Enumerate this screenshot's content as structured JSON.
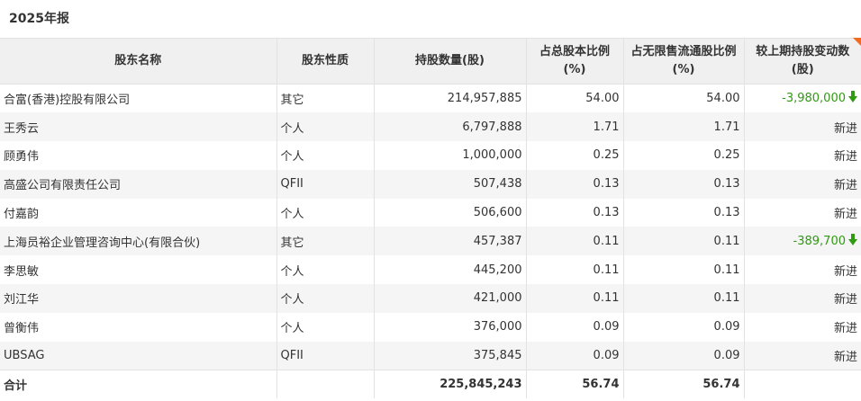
{
  "report_title": "2025年报",
  "columns": {
    "name": "股东名称",
    "type": "股东性质",
    "shares": "持股数量(股)",
    "total_pct": "占总股本比例(%)",
    "float_pct": "占无限售流通股比例(%)",
    "change": "较上期持股变动数(股)"
  },
  "rows": [
    {
      "name": "合富(香港)控股有限公司",
      "type": "其它",
      "shares": "214,957,885",
      "total_pct": "54.00",
      "float_pct": "54.00",
      "change": "-3,980,000",
      "change_dir": "down"
    },
    {
      "name": "王秀云",
      "type": "个人",
      "shares": "6,797,888",
      "total_pct": "1.71",
      "float_pct": "1.71",
      "change": "新进",
      "change_dir": ""
    },
    {
      "name": "顾勇伟",
      "type": "个人",
      "shares": "1,000,000",
      "total_pct": "0.25",
      "float_pct": "0.25",
      "change": "新进",
      "change_dir": ""
    },
    {
      "name": "高盛公司有限责任公司",
      "type": "QFII",
      "shares": "507,438",
      "total_pct": "0.13",
      "float_pct": "0.13",
      "change": "新进",
      "change_dir": ""
    },
    {
      "name": "付嘉韵",
      "type": "个人",
      "shares": "506,600",
      "total_pct": "0.13",
      "float_pct": "0.13",
      "change": "新进",
      "change_dir": ""
    },
    {
      "name": "上海员裕企业管理咨询中心(有限合伙)",
      "type": "其它",
      "shares": "457,387",
      "total_pct": "0.11",
      "float_pct": "0.11",
      "change": "-389,700",
      "change_dir": "down"
    },
    {
      "name": "李思敏",
      "type": "个人",
      "shares": "445,200",
      "total_pct": "0.11",
      "float_pct": "0.11",
      "change": "新进",
      "change_dir": ""
    },
    {
      "name": "刘江华",
      "type": "个人",
      "shares": "421,000",
      "total_pct": "0.11",
      "float_pct": "0.11",
      "change": "新进",
      "change_dir": ""
    },
    {
      "name": "曾衡伟",
      "type": "个人",
      "shares": "376,000",
      "total_pct": "0.09",
      "float_pct": "0.09",
      "change": "新进",
      "change_dir": ""
    },
    {
      "name": "UBSAG",
      "type": "QFII",
      "shares": "375,845",
      "total_pct": "0.09",
      "float_pct": "0.09",
      "change": "新进",
      "change_dir": ""
    }
  ],
  "total": {
    "name": "合计",
    "type": "",
    "shares": "225,845,243",
    "total_pct": "56.74",
    "float_pct": "56.74",
    "change": ""
  },
  "colors": {
    "decrease": "#2f9a12",
    "header_bg": "#f0f0f0",
    "stripe_bg": "#f5f5f5",
    "corner_flag": "#f26b21"
  },
  "icons": {
    "decrease": "arrow-down-icon"
  }
}
